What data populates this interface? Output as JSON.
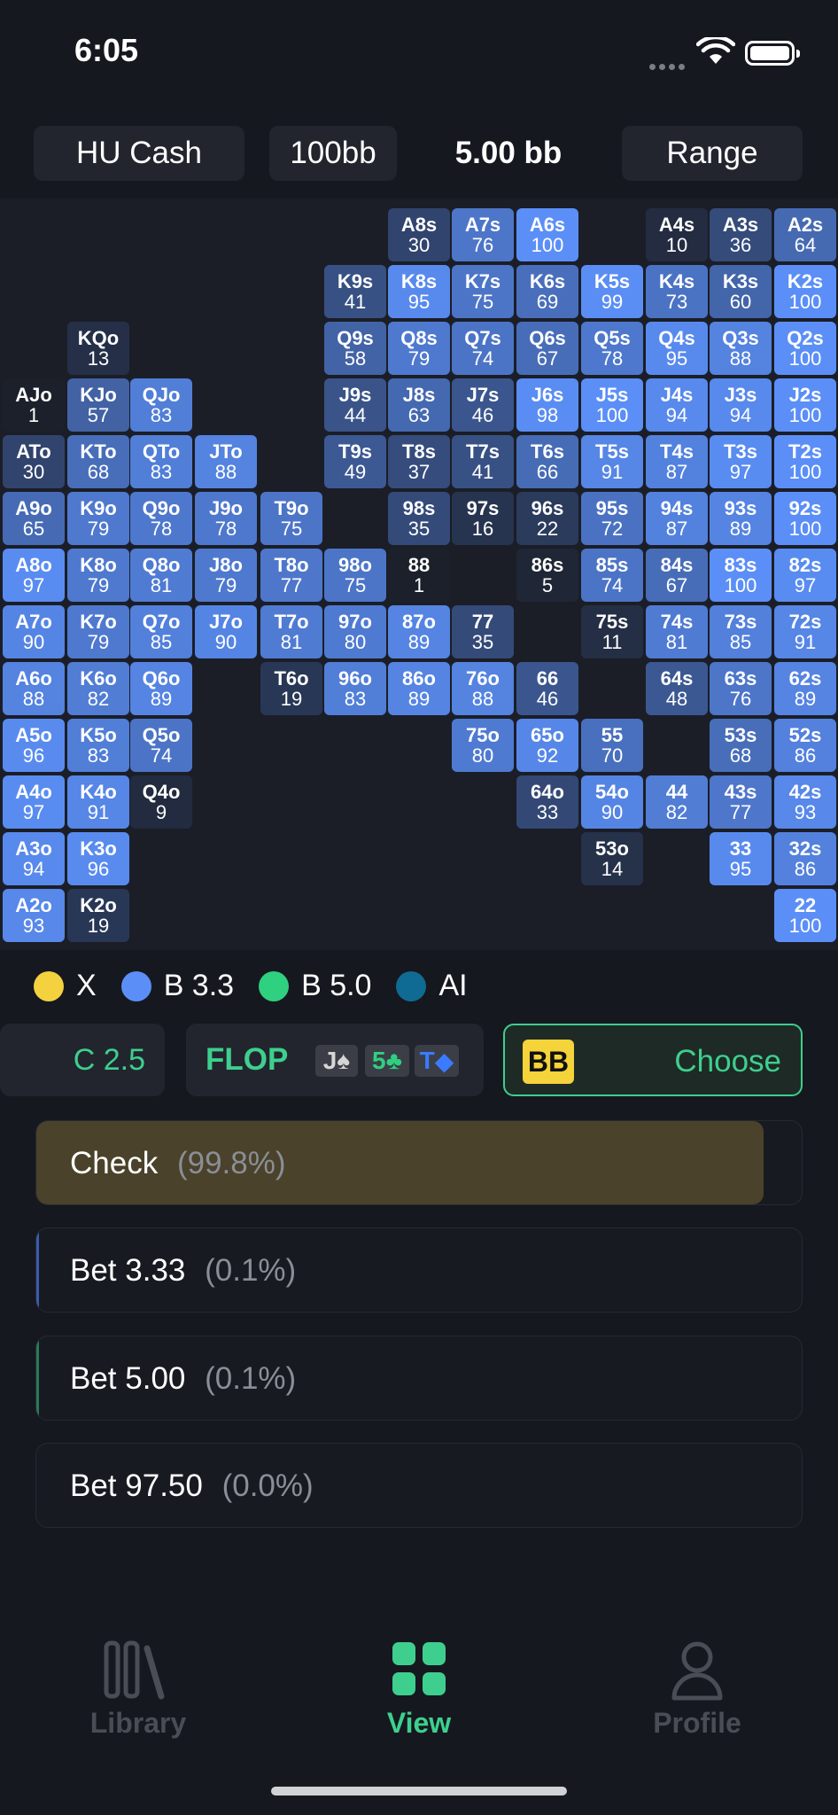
{
  "status_bar": {
    "time": "6:05"
  },
  "header": {
    "game": "HU Cash",
    "stack": "100bb",
    "pot": "5.00 bb",
    "range_button": "Range"
  },
  "colors": {
    "check": "#f4d13e",
    "bet_small": "#5b8ff7",
    "bet_big": "#2fd080",
    "allin": "#0f6b93",
    "cell_bg": "#1b1e27",
    "accent_green": "#3ecf8e"
  },
  "legend": [
    {
      "label": "X",
      "color": "#f4d13e"
    },
    {
      "label": "B 3.3",
      "color": "#5b8ff7"
    },
    {
      "label": "B 5.0",
      "color": "#2fd080"
    },
    {
      "label": "AI",
      "color": "#0f6b93"
    }
  ],
  "range_cells": [
    {
      "hand": "A8s",
      "pct": "30",
      "r": 0,
      "c": 6
    },
    {
      "hand": "A7s",
      "pct": "76",
      "r": 0,
      "c": 7
    },
    {
      "hand": "A6s",
      "pct": "100",
      "r": 0,
      "c": 8
    },
    {
      "hand": "A4s",
      "pct": "10",
      "r": 0,
      "c": 10
    },
    {
      "hand": "A3s",
      "pct": "36",
      "r": 0,
      "c": 11
    },
    {
      "hand": "A2s",
      "pct": "64",
      "r": 0,
      "c": 12
    },
    {
      "hand": "K9s",
      "pct": "41",
      "r": 1,
      "c": 5
    },
    {
      "hand": "K8s",
      "pct": "95",
      "r": 1,
      "c": 6
    },
    {
      "hand": "K7s",
      "pct": "75",
      "r": 1,
      "c": 7
    },
    {
      "hand": "K6s",
      "pct": "69",
      "r": 1,
      "c": 8
    },
    {
      "hand": "K5s",
      "pct": "99",
      "r": 1,
      "c": 9
    },
    {
      "hand": "K4s",
      "pct": "73",
      "r": 1,
      "c": 10
    },
    {
      "hand": "K3s",
      "pct": "60",
      "r": 1,
      "c": 11
    },
    {
      "hand": "K2s",
      "pct": "100",
      "r": 1,
      "c": 12
    },
    {
      "hand": "KQo",
      "pct": "13",
      "r": 2,
      "c": 1
    },
    {
      "hand": "Q9s",
      "pct": "58",
      "r": 2,
      "c": 5
    },
    {
      "hand": "Q8s",
      "pct": "79",
      "r": 2,
      "c": 6
    },
    {
      "hand": "Q7s",
      "pct": "74",
      "r": 2,
      "c": 7
    },
    {
      "hand": "Q6s",
      "pct": "67",
      "r": 2,
      "c": 8
    },
    {
      "hand": "Q5s",
      "pct": "78",
      "r": 2,
      "c": 9
    },
    {
      "hand": "Q4s",
      "pct": "95",
      "r": 2,
      "c": 10
    },
    {
      "hand": "Q3s",
      "pct": "88",
      "r": 2,
      "c": 11
    },
    {
      "hand": "Q2s",
      "pct": "100",
      "r": 2,
      "c": 12
    },
    {
      "hand": "AJo",
      "pct": "1",
      "r": 3,
      "c": 0
    },
    {
      "hand": "KJo",
      "pct": "57",
      "r": 3,
      "c": 1
    },
    {
      "hand": "QJo",
      "pct": "83",
      "r": 3,
      "c": 2
    },
    {
      "hand": "J9s",
      "pct": "44",
      "r": 3,
      "c": 5
    },
    {
      "hand": "J8s",
      "pct": "63",
      "r": 3,
      "c": 6
    },
    {
      "hand": "J7s",
      "pct": "46",
      "r": 3,
      "c": 7
    },
    {
      "hand": "J6s",
      "pct": "98",
      "r": 3,
      "c": 8
    },
    {
      "hand": "J5s",
      "pct": "100",
      "r": 3,
      "c": 9
    },
    {
      "hand": "J4s",
      "pct": "94",
      "r": 3,
      "c": 10
    },
    {
      "hand": "J3s",
      "pct": "94",
      "r": 3,
      "c": 11
    },
    {
      "hand": "J2s",
      "pct": "100",
      "r": 3,
      "c": 12
    },
    {
      "hand": "ATo",
      "pct": "30",
      "r": 4,
      "c": 0
    },
    {
      "hand": "KTo",
      "pct": "68",
      "r": 4,
      "c": 1
    },
    {
      "hand": "QTo",
      "pct": "83",
      "r": 4,
      "c": 2
    },
    {
      "hand": "JTo",
      "pct": "88",
      "r": 4,
      "c": 3
    },
    {
      "hand": "T9s",
      "pct": "49",
      "r": 4,
      "c": 5
    },
    {
      "hand": "T8s",
      "pct": "37",
      "r": 4,
      "c": 6
    },
    {
      "hand": "T7s",
      "pct": "41",
      "r": 4,
      "c": 7
    },
    {
      "hand": "T6s",
      "pct": "66",
      "r": 4,
      "c": 8
    },
    {
      "hand": "T5s",
      "pct": "91",
      "r": 4,
      "c": 9
    },
    {
      "hand": "T4s",
      "pct": "87",
      "r": 4,
      "c": 10
    },
    {
      "hand": "T3s",
      "pct": "97",
      "r": 4,
      "c": 11
    },
    {
      "hand": "T2s",
      "pct": "100",
      "r": 4,
      "c": 12
    },
    {
      "hand": "A9o",
      "pct": "65",
      "r": 5,
      "c": 0
    },
    {
      "hand": "K9o",
      "pct": "79",
      "r": 5,
      "c": 1
    },
    {
      "hand": "Q9o",
      "pct": "78",
      "r": 5,
      "c": 2
    },
    {
      "hand": "J9o",
      "pct": "78",
      "r": 5,
      "c": 3
    },
    {
      "hand": "T9o",
      "pct": "75",
      "r": 5,
      "c": 4
    },
    {
      "hand": "98s",
      "pct": "35",
      "r": 5,
      "c": 6
    },
    {
      "hand": "97s",
      "pct": "16",
      "r": 5,
      "c": 7
    },
    {
      "hand": "96s",
      "pct": "22",
      "r": 5,
      "c": 8
    },
    {
      "hand": "95s",
      "pct": "72",
      "r": 5,
      "c": 9
    },
    {
      "hand": "94s",
      "pct": "87",
      "r": 5,
      "c": 10
    },
    {
      "hand": "93s",
      "pct": "89",
      "r": 5,
      "c": 11
    },
    {
      "hand": "92s",
      "pct": "100",
      "r": 5,
      "c": 12
    },
    {
      "hand": "A8o",
      "pct": "97",
      "r": 6,
      "c": 0
    },
    {
      "hand": "K8o",
      "pct": "79",
      "r": 6,
      "c": 1
    },
    {
      "hand": "Q8o",
      "pct": "81",
      "r": 6,
      "c": 2
    },
    {
      "hand": "J8o",
      "pct": "79",
      "r": 6,
      "c": 3
    },
    {
      "hand": "T8o",
      "pct": "77",
      "r": 6,
      "c": 4
    },
    {
      "hand": "98o",
      "pct": "75",
      "r": 6,
      "c": 5
    },
    {
      "hand": "88",
      "pct": "1",
      "r": 6,
      "c": 6
    },
    {
      "hand": "86s",
      "pct": "5",
      "r": 6,
      "c": 8
    },
    {
      "hand": "85s",
      "pct": "74",
      "r": 6,
      "c": 9
    },
    {
      "hand": "84s",
      "pct": "67",
      "r": 6,
      "c": 10
    },
    {
      "hand": "83s",
      "pct": "100",
      "r": 6,
      "c": 11
    },
    {
      "hand": "82s",
      "pct": "97",
      "r": 6,
      "c": 12
    },
    {
      "hand": "A7o",
      "pct": "90",
      "r": 7,
      "c": 0
    },
    {
      "hand": "K7o",
      "pct": "79",
      "r": 7,
      "c": 1
    },
    {
      "hand": "Q7o",
      "pct": "85",
      "r": 7,
      "c": 2
    },
    {
      "hand": "J7o",
      "pct": "90",
      "r": 7,
      "c": 3
    },
    {
      "hand": "T7o",
      "pct": "81",
      "r": 7,
      "c": 4
    },
    {
      "hand": "97o",
      "pct": "80",
      "r": 7,
      "c": 5
    },
    {
      "hand": "87o",
      "pct": "89",
      "r": 7,
      "c": 6
    },
    {
      "hand": "77",
      "pct": "35",
      "r": 7,
      "c": 7
    },
    {
      "hand": "75s",
      "pct": "11",
      "r": 7,
      "c": 9
    },
    {
      "hand": "74s",
      "pct": "81",
      "r": 7,
      "c": 10
    },
    {
      "hand": "73s",
      "pct": "85",
      "r": 7,
      "c": 11
    },
    {
      "hand": "72s",
      "pct": "91",
      "r": 7,
      "c": 12
    },
    {
      "hand": "A6o",
      "pct": "88",
      "r": 8,
      "c": 0
    },
    {
      "hand": "K6o",
      "pct": "82",
      "r": 8,
      "c": 1
    },
    {
      "hand": "Q6o",
      "pct": "89",
      "r": 8,
      "c": 2
    },
    {
      "hand": "T6o",
      "pct": "19",
      "r": 8,
      "c": 4
    },
    {
      "hand": "96o",
      "pct": "83",
      "r": 8,
      "c": 5
    },
    {
      "hand": "86o",
      "pct": "89",
      "r": 8,
      "c": 6
    },
    {
      "hand": "76o",
      "pct": "88",
      "r": 8,
      "c": 7
    },
    {
      "hand": "66",
      "pct": "46",
      "r": 8,
      "c": 8
    },
    {
      "hand": "64s",
      "pct": "48",
      "r": 8,
      "c": 10
    },
    {
      "hand": "63s",
      "pct": "76",
      "r": 8,
      "c": 11
    },
    {
      "hand": "62s",
      "pct": "89",
      "r": 8,
      "c": 12
    },
    {
      "hand": "A5o",
      "pct": "96",
      "r": 9,
      "c": 0
    },
    {
      "hand": "K5o",
      "pct": "83",
      "r": 9,
      "c": 1
    },
    {
      "hand": "Q5o",
      "pct": "74",
      "r": 9,
      "c": 2
    },
    {
      "hand": "75o",
      "pct": "80",
      "r": 9,
      "c": 7
    },
    {
      "hand": "65o",
      "pct": "92",
      "r": 9,
      "c": 8
    },
    {
      "hand": "55",
      "pct": "70",
      "r": 9,
      "c": 9
    },
    {
      "hand": "53s",
      "pct": "68",
      "r": 9,
      "c": 11
    },
    {
      "hand": "52s",
      "pct": "86",
      "r": 9,
      "c": 12
    },
    {
      "hand": "A4o",
      "pct": "97",
      "r": 10,
      "c": 0
    },
    {
      "hand": "K4o",
      "pct": "91",
      "r": 10,
      "c": 1
    },
    {
      "hand": "Q4o",
      "pct": "9",
      "r": 10,
      "c": 2
    },
    {
      "hand": "64o",
      "pct": "33",
      "r": 10,
      "c": 8
    },
    {
      "hand": "54o",
      "pct": "90",
      "r": 10,
      "c": 9
    },
    {
      "hand": "44",
      "pct": "82",
      "r": 10,
      "c": 10
    },
    {
      "hand": "43s",
      "pct": "77",
      "r": 10,
      "c": 11
    },
    {
      "hand": "42s",
      "pct": "93",
      "r": 10,
      "c": 12
    },
    {
      "hand": "A3o",
      "pct": "94",
      "r": 11,
      "c": 0
    },
    {
      "hand": "K3o",
      "pct": "96",
      "r": 11,
      "c": 1
    },
    {
      "hand": "53o",
      "pct": "14",
      "r": 11,
      "c": 9
    },
    {
      "hand": "33",
      "pct": "95",
      "r": 11,
      "c": 11
    },
    {
      "hand": "32s",
      "pct": "86",
      "r": 11,
      "c": 12
    },
    {
      "hand": "A2o",
      "pct": "93",
      "r": 12,
      "c": 0
    },
    {
      "hand": "K2o",
      "pct": "19",
      "r": 12,
      "c": 1
    },
    {
      "hand": "22",
      "pct": "100",
      "r": 12,
      "c": 12
    }
  ],
  "street_row": {
    "prev_action": "C 2.5",
    "street_label": "FLOP",
    "board": [
      {
        "rank": "J",
        "suit": "♠",
        "color": "#d6d6d6"
      },
      {
        "rank": "5",
        "suit": "♣",
        "color": "#2fd080"
      },
      {
        "rank": "T",
        "suit": "◆",
        "color": "#3b7bff"
      }
    ],
    "player_badge": "BB",
    "choose_label": "Choose"
  },
  "actions": [
    {
      "label": "Check",
      "pct": "(99.8%)",
      "frac": 0.998,
      "color": "#4a422a"
    },
    {
      "label": "Bet 3.33",
      "pct": "(0.1%)",
      "frac": 0.001,
      "color": "#3a5cae"
    },
    {
      "label": "Bet 5.00",
      "pct": "(0.1%)",
      "frac": 0.001,
      "color": "#2a7a55"
    },
    {
      "label": "Bet 97.50",
      "pct": "(0.0%)",
      "frac": 0.0,
      "color": "#0f6b93"
    }
  ],
  "tabs": [
    {
      "label": "Library",
      "active": false
    },
    {
      "label": "View",
      "active": true
    },
    {
      "label": "Profile",
      "active": false
    }
  ]
}
